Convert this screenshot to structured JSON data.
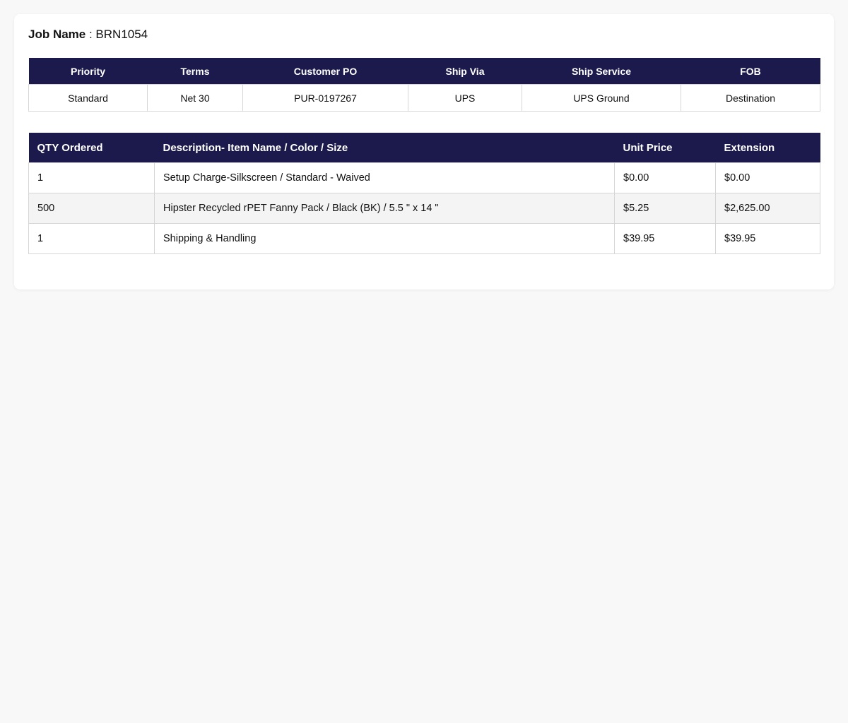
{
  "job": {
    "label": "Job Name",
    "separator": " : ",
    "value": "BRN1054"
  },
  "info_table": {
    "headers": [
      "Priority",
      "Terms",
      "Customer PO",
      "Ship Via",
      "Ship Service",
      "FOB"
    ],
    "row": [
      "Standard",
      "Net 30",
      "PUR-0197267",
      "UPS",
      "UPS Ground",
      "Destination"
    ]
  },
  "items_table": {
    "headers": [
      "QTY Ordered",
      "Description- Item Name / Color / Size",
      "Unit Price",
      "Extension"
    ],
    "rows": [
      [
        "1",
        "Setup Charge-Silkscreen / Standard - Waived",
        "$0.00",
        "$0.00"
      ],
      [
        "500",
        "Hipster Recycled rPET Fanny Pack / Black (BK) / 5.5 \" x 14 \"",
        "$5.25",
        "$2,625.00"
      ],
      [
        "1",
        "Shipping & Handling",
        "$39.95",
        "$39.95"
      ]
    ]
  },
  "colors": {
    "header_bg": "#1c1a4c",
    "alt_row_bg": "#f4f4f4"
  }
}
